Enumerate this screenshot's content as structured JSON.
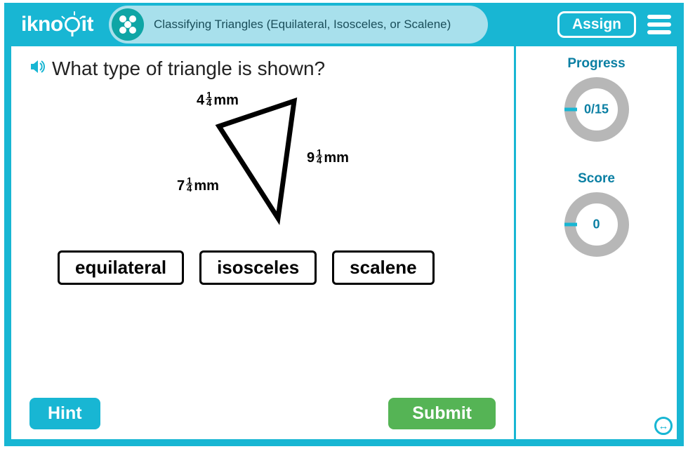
{
  "header": {
    "logo_left": "ikno",
    "logo_right": "it",
    "lesson_title": "Classifying Triangles (Equilateral, Isosceles, or Scalene)",
    "assign_label": "Assign"
  },
  "question": {
    "text": "What type of triangle is shown?",
    "sides": {
      "a_whole": "4",
      "a_num": "1",
      "a_den": "4",
      "a_unit": "mm",
      "b_whole": "9",
      "b_num": "1",
      "b_den": "4",
      "b_unit": "mm",
      "c_whole": "7",
      "c_num": "1",
      "c_den": "4",
      "c_unit": "mm"
    }
  },
  "options": {
    "opt1": "equilateral",
    "opt2": "isosceles",
    "opt3": "scalene"
  },
  "buttons": {
    "hint": "Hint",
    "submit": "Submit"
  },
  "sidebar": {
    "progress_label": "Progress",
    "progress_value": "0/15",
    "score_label": "Score",
    "score_value": "0"
  }
}
